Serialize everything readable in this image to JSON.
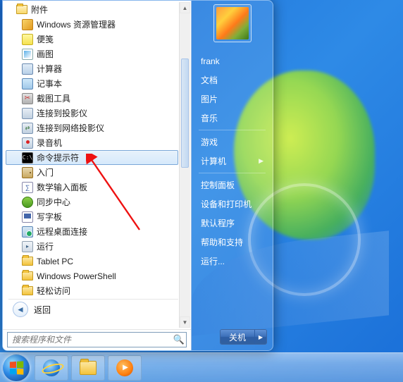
{
  "left": {
    "parent_folder": "附件",
    "items": [
      {
        "label": "Windows 资源管理器",
        "ic": "ic-explorer"
      },
      {
        "label": "便笺",
        "ic": "ic-sticky"
      },
      {
        "label": "画图",
        "ic": "ic-paint"
      },
      {
        "label": "计算器",
        "ic": "ic-calc"
      },
      {
        "label": "记事本",
        "ic": "ic-notepad"
      },
      {
        "label": "截图工具",
        "ic": "ic-snip"
      },
      {
        "label": "连接到投影仪",
        "ic": "ic-proj"
      },
      {
        "label": "连接到网络投影仪",
        "ic": "ic-projnet"
      },
      {
        "label": "录音机",
        "ic": "ic-rec"
      },
      {
        "label": "命令提示符",
        "ic": "ic-cmd",
        "highlight": true
      },
      {
        "label": "入门",
        "ic": "ic-door"
      },
      {
        "label": "数学输入面板",
        "ic": "ic-math"
      },
      {
        "label": "同步中心",
        "ic": "ic-sync"
      },
      {
        "label": "写字板",
        "ic": "ic-tablet"
      },
      {
        "label": "远程桌面连接",
        "ic": "ic-rdp"
      },
      {
        "label": "运行",
        "ic": "ic-run"
      },
      {
        "label": "Tablet PC",
        "ic": "folder"
      },
      {
        "label": "Windows PowerShell",
        "ic": "ic-ps-folder"
      },
      {
        "label": "轻松访问",
        "ic": "folder"
      }
    ],
    "back_label": "返回",
    "search_placeholder": "搜索程序和文件"
  },
  "right": {
    "username": "frank",
    "group1": [
      "文档",
      "图片",
      "音乐"
    ],
    "group2": [
      "游戏",
      "计算机"
    ],
    "group3": [
      "控制面板",
      "设备和打印机",
      "默认程序",
      "帮助和支持",
      "运行..."
    ],
    "shutdown_label": "关机"
  },
  "taskbar": {
    "items": [
      "internet-explorer",
      "file-explorer",
      "windows-media-player"
    ]
  }
}
